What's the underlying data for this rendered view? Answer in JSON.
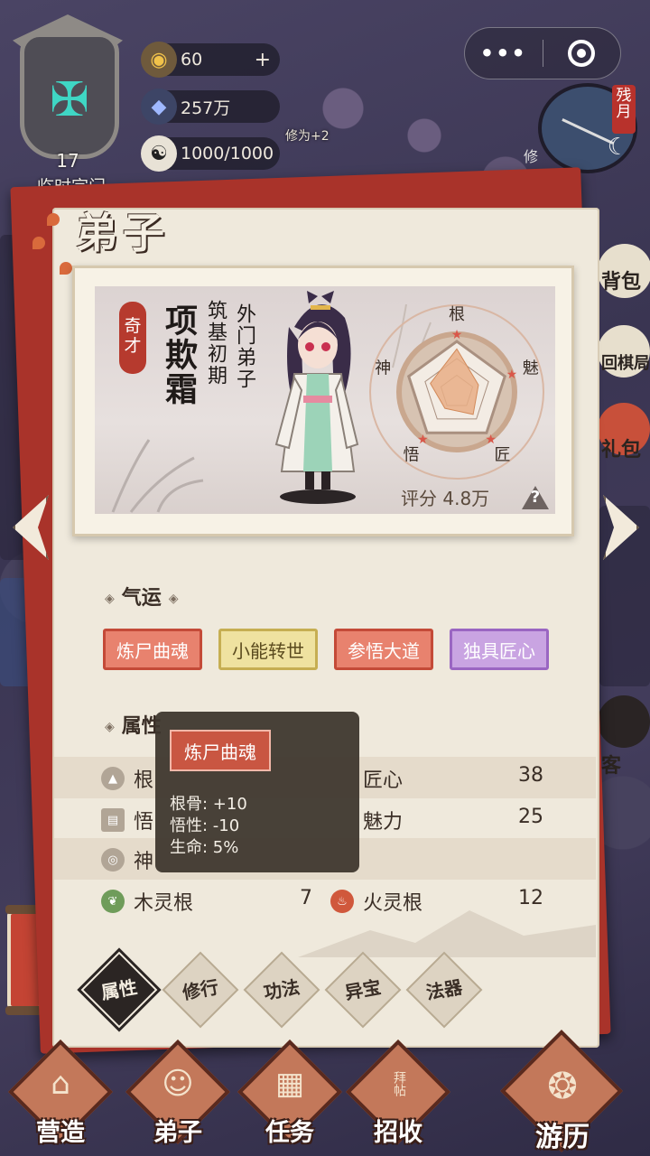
{
  "sect": {
    "level": "17",
    "name": "临时宗门"
  },
  "resources": [
    {
      "icon": "gold-ingot-icon",
      "value": "60",
      "plus": "+"
    },
    {
      "icon": "spirit-stone-icon",
      "value": "257万"
    },
    {
      "icon": "yin-yang-icon",
      "value": "1000/1000"
    }
  ],
  "scene": {
    "bonus_text": "修为+2",
    "moon_badge": "残月",
    "moon_label": "修"
  },
  "side_menu": [
    "背包",
    "回棋局",
    "礼包",
    "客"
  ],
  "panel": {
    "title": "弟子"
  },
  "disciple": {
    "talent_tag": "奇才",
    "name": "项欺霜",
    "realm": "筑基初期",
    "rank": "外门弟子",
    "score_label": "评分",
    "score_value": "4.8万",
    "radar_labels": [
      "根",
      "魅",
      "匠",
      "悟",
      "神"
    ],
    "radar_values": [
      0.85,
      0.45,
      0.55,
      0.4,
      0.55
    ]
  },
  "fortune": {
    "heading": "气运",
    "tags": [
      {
        "label": "炼尸曲魂",
        "style": "red"
      },
      {
        "label": "小能转世",
        "style": "yellow"
      },
      {
        "label": "参悟大道",
        "style": "red"
      },
      {
        "label": "独具匠心",
        "style": "purple"
      }
    ]
  },
  "attributes": {
    "heading": "属性",
    "rows": [
      {
        "left_label": "根",
        "left_value": "",
        "right_label": "匠心",
        "right_value": "38"
      },
      {
        "left_label": "悟",
        "left_value": "",
        "right_label": "魅力",
        "right_value": "25"
      },
      {
        "left_label": "神",
        "left_value": "",
        "right_label": "",
        "right_value": ""
      },
      {
        "left_label": "木灵根",
        "left_value": "7",
        "right_label": "火灵根",
        "right_value": "12"
      }
    ]
  },
  "tooltip": {
    "title": "炼尸曲魂",
    "lines": [
      "根骨: +10",
      "悟性: -10",
      "生命: 5%"
    ]
  },
  "panel_tabs": [
    {
      "label": "属性",
      "active": true
    },
    {
      "label": "修行",
      "active": false
    },
    {
      "label": "功法",
      "active": false
    },
    {
      "label": "异宝",
      "active": false
    },
    {
      "label": "法器",
      "active": false
    }
  ],
  "bottom_nav": [
    {
      "label": "营造",
      "icon": "pavilion-icon"
    },
    {
      "label": "弟子",
      "icon": "disciples-icon"
    },
    {
      "label": "任务",
      "icon": "scroll-icon"
    },
    {
      "label": "招收",
      "icon": "invitation-icon",
      "card_text": "拜帖"
    },
    {
      "label": "游历",
      "icon": "journey-icon"
    }
  ],
  "colors": {
    "panel_bg": "#efe9dc",
    "panel_back": "#a9332a",
    "tag_red": "#e8826e",
    "tag_yellow": "#efe2a0",
    "tag_purple": "#c9a4e2",
    "radar_fill": "#e7ae86"
  }
}
